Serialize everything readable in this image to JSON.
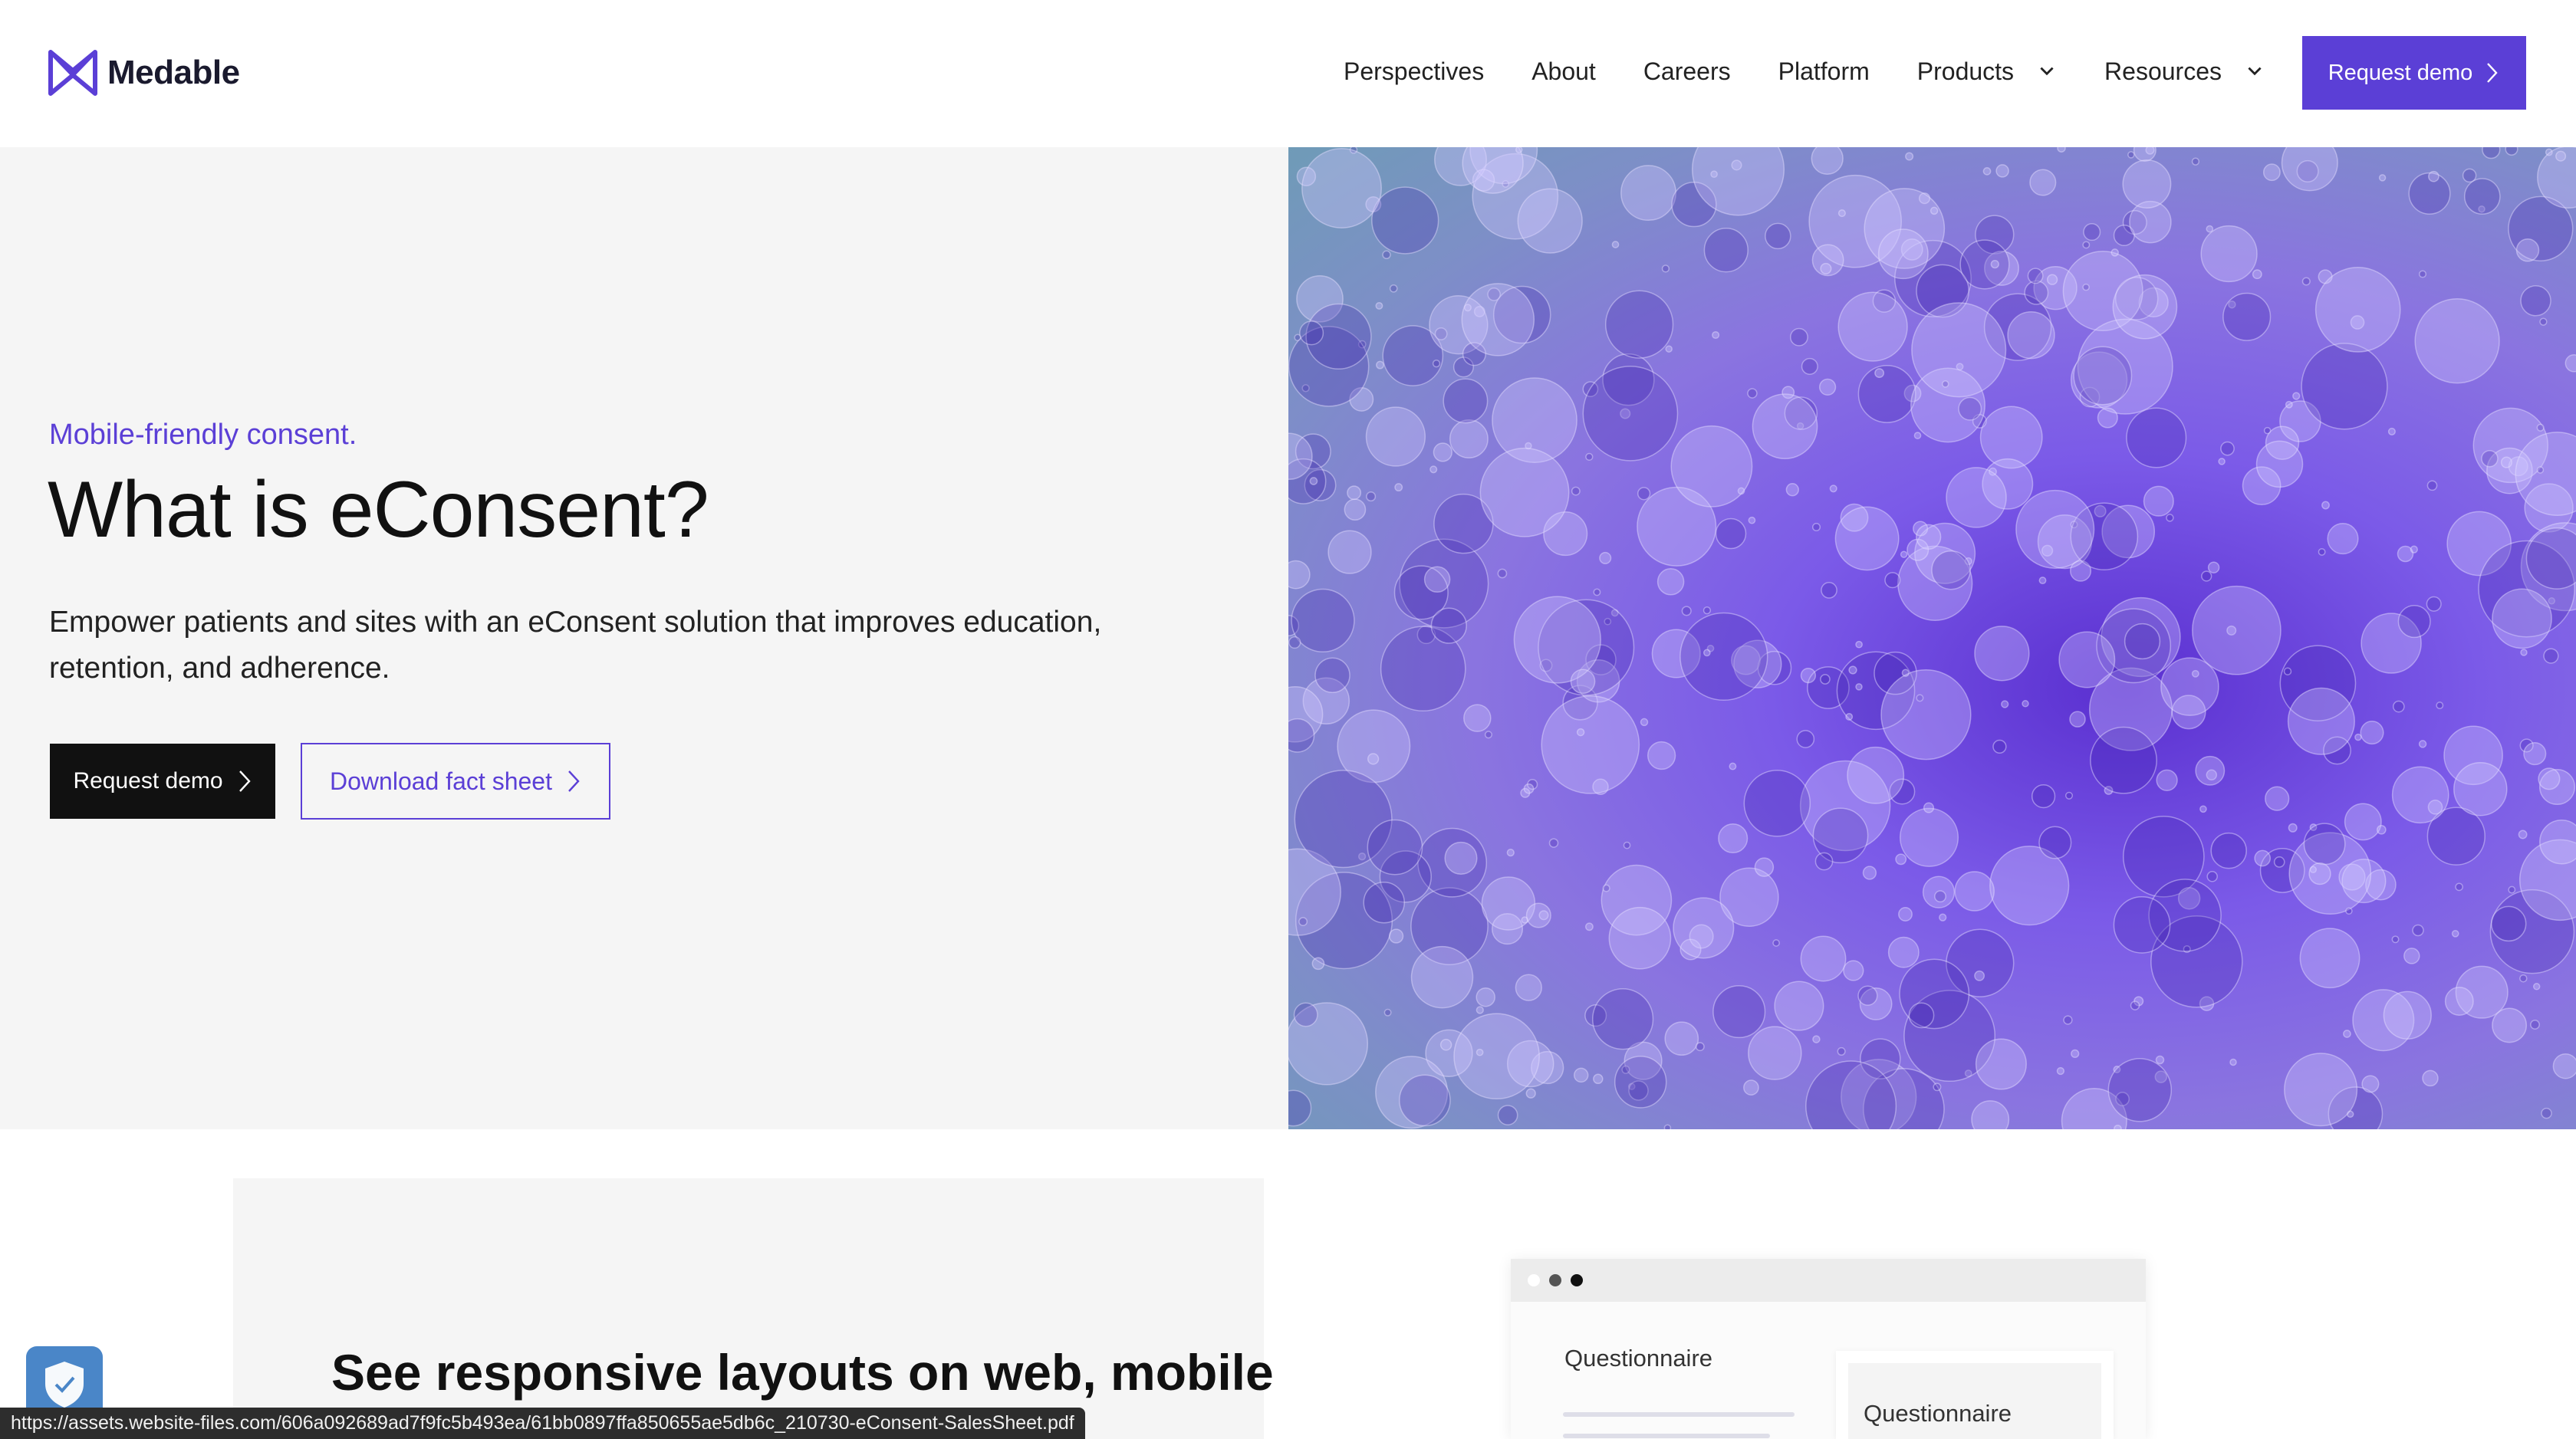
{
  "header": {
    "logo_text": "Medable",
    "nav": [
      {
        "label": "Perspectives",
        "has_dropdown": false
      },
      {
        "label": "About",
        "has_dropdown": false
      },
      {
        "label": "Careers",
        "has_dropdown": false
      },
      {
        "label": "Platform",
        "has_dropdown": false
      },
      {
        "label": "Products",
        "has_dropdown": true
      },
      {
        "label": "Resources",
        "has_dropdown": true
      }
    ],
    "cta_label": "Request demo"
  },
  "hero": {
    "eyebrow": "Mobile-friendly consent.",
    "headline": "What is eConsent?",
    "subtext": "Empower patients and sites with an eConsent solution that improves education, retention, and adherence.",
    "primary_button": "Request demo",
    "secondary_button": "Download fact sheet"
  },
  "section2": {
    "title": "See responsive layouts on web, mobile",
    "mock": {
      "left_label": "Questionnaire",
      "card_label": "Questionnaire"
    }
  },
  "status_bar": {
    "url": "https://assets.website-files.com/606a092689ad7f9fc5b493ea/61bb0897ffa850655ae5db6c_210730-eConsent-SalesSheet.pdf"
  },
  "colors": {
    "accent": "#5b3fd6",
    "hero_panel": "#f5f5f5",
    "primary_button": "#111111"
  },
  "icons": {
    "logo": "medable-logo-icon",
    "dropdown": "chevron-down-icon",
    "arrow": "chevron-right-icon",
    "privacy_widget": "shield-check-icon"
  }
}
